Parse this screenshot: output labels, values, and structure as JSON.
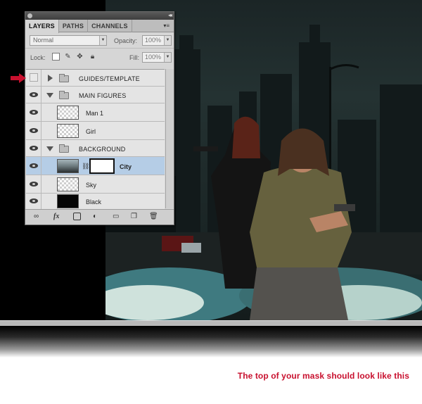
{
  "panel": {
    "tabs": [
      {
        "label": "LAYERS",
        "active": true
      },
      {
        "label": "PATHS",
        "active": false
      },
      {
        "label": "CHANNELS",
        "active": false
      }
    ],
    "collapse_glyph": "◂◂",
    "menu_glyph": "▾≡",
    "blend_mode": "Normal",
    "opacity_label": "Opacity:",
    "opacity_value": "100%",
    "lock_label": "Lock:",
    "fill_label": "Fill:",
    "fill_value": "100%",
    "layers": [
      {
        "name": "GUIDES/TEMPLATE",
        "kind": "group",
        "expanded": false,
        "visible": false
      },
      {
        "name": "MAIN FIGURES",
        "kind": "group",
        "expanded": true,
        "visible": true
      },
      {
        "name": "Man 1",
        "kind": "layer",
        "visible": true
      },
      {
        "name": "Girl",
        "kind": "layer",
        "visible": true
      },
      {
        "name": "BACKGROUND",
        "kind": "group",
        "expanded": true,
        "visible": true
      },
      {
        "name": "City",
        "kind": "layer-with-mask",
        "visible": true,
        "selected": true
      },
      {
        "name": "Sky",
        "kind": "layer",
        "visible": true
      },
      {
        "name": "Black",
        "kind": "layer",
        "visible": true
      }
    ],
    "footer_icons": [
      "link-icon",
      "fx-icon",
      "mask-icon",
      "adjustment-icon",
      "new-group-icon",
      "new-layer-icon",
      "trash-icon"
    ]
  },
  "colors": {
    "accent_red": "#c8102e",
    "selected_row": "#b5cde6"
  },
  "caption": "The top of your mask should look like this"
}
